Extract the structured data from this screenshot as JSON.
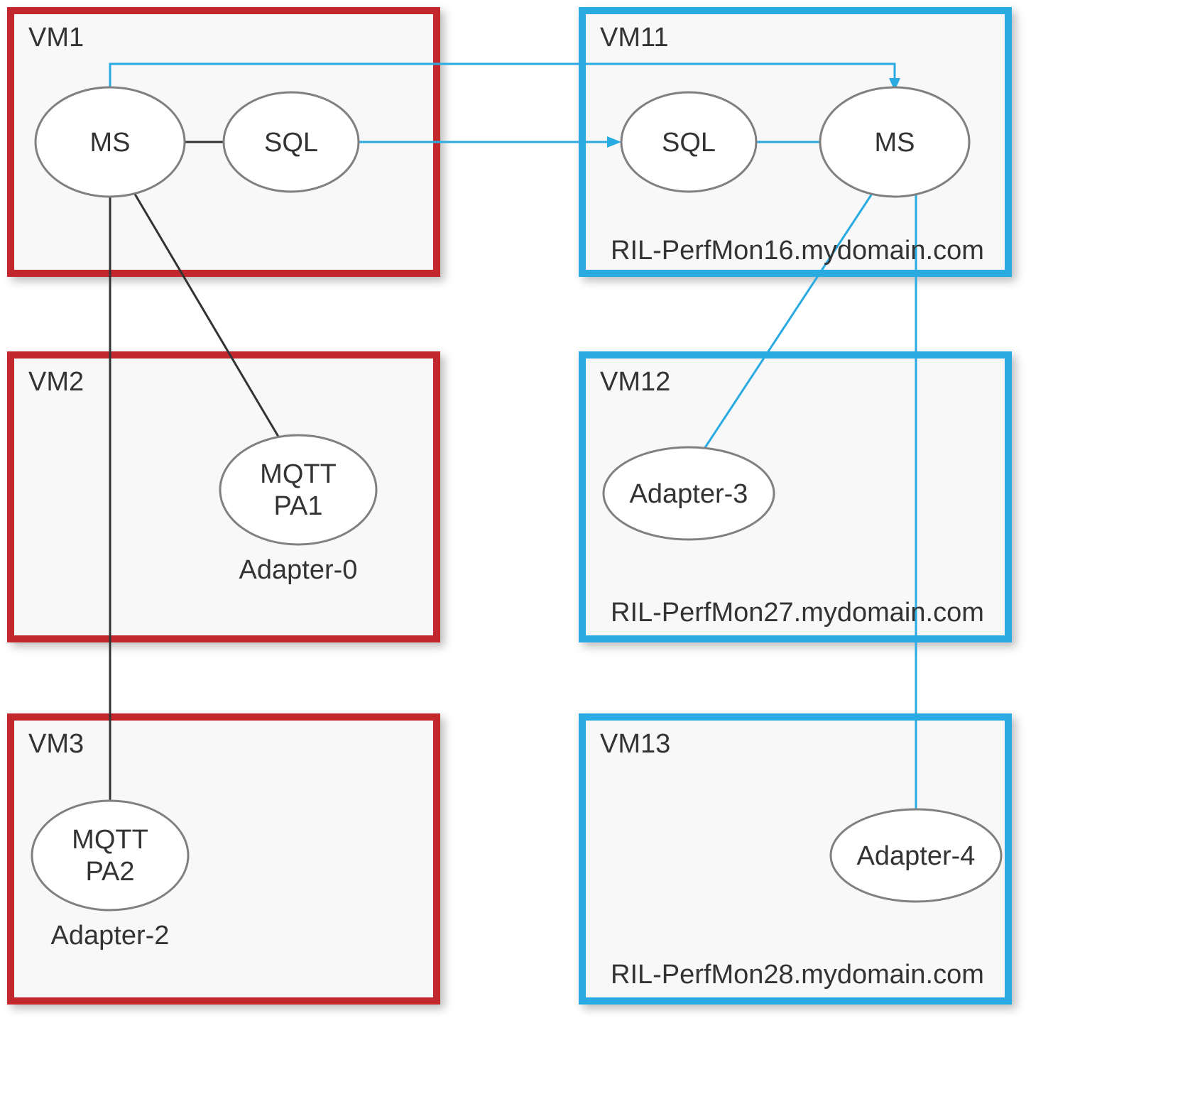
{
  "diagram": {
    "boxes": {
      "vm1": {
        "title": "VM1",
        "subtitle": ""
      },
      "vm2": {
        "title": "VM2",
        "subtitle": ""
      },
      "vm3": {
        "title": "VM3",
        "subtitle": ""
      },
      "vm11": {
        "title": "VM11",
        "subtitle": "RIL-PerfMon16.mydomain.com"
      },
      "vm12": {
        "title": "VM12",
        "subtitle": "RIL-PerfMon27.mydomain.com"
      },
      "vm13": {
        "title": "VM13",
        "subtitle": "RIL-PerfMon28.mydomain.com"
      }
    },
    "nodes": {
      "ms_left": {
        "label": "MS"
      },
      "sql_left": {
        "label": "SQL"
      },
      "sql_right": {
        "label": "SQL"
      },
      "ms_right": {
        "label": "MS"
      },
      "mqtt_pa1": {
        "line1": "MQTT",
        "line2": "PA1",
        "caption": "Adapter-0"
      },
      "mqtt_pa2": {
        "line1": "MQTT",
        "line2": "PA2",
        "caption": "Adapter-2"
      },
      "adapter3": {
        "label": "Adapter-3"
      },
      "adapter4": {
        "label": "Adapter-4"
      }
    },
    "connections": [
      {
        "from": "ms_left",
        "to": "sql_left",
        "style": "black"
      },
      {
        "from": "ms_left",
        "to": "mqtt_pa1",
        "style": "black"
      },
      {
        "from": "ms_left",
        "to": "mqtt_pa2",
        "style": "black"
      },
      {
        "from": "sql_left",
        "to": "sql_right",
        "style": "blue-arrow"
      },
      {
        "from": "ms_left",
        "to": "ms_right",
        "style": "blue-arrow-elbow"
      },
      {
        "from": "sql_right",
        "to": "ms_right",
        "style": "blue"
      },
      {
        "from": "ms_right",
        "to": "adapter3",
        "style": "blue"
      },
      {
        "from": "ms_right",
        "to": "adapter4",
        "style": "blue"
      }
    ]
  }
}
